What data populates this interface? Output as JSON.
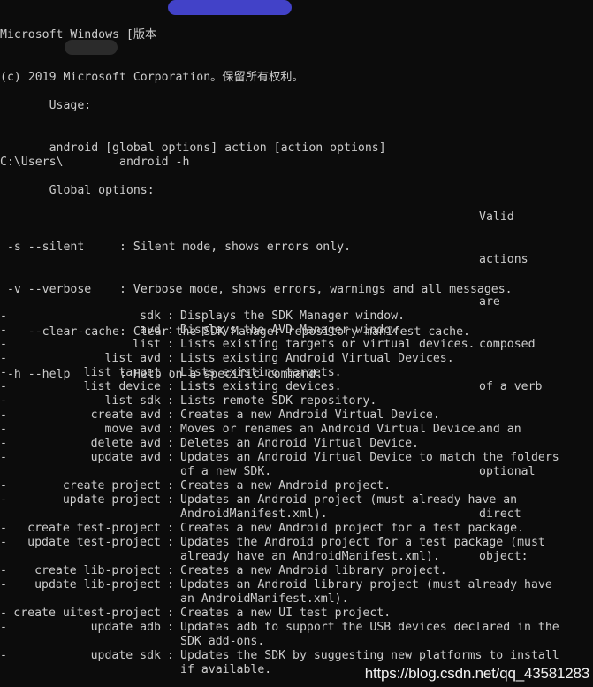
{
  "terminal": {
    "background_color": "#0c0c0c",
    "text_color": "#cccccc",
    "header": {
      "line1": "Microsoft Windows [版本",
      "line2": "(c) 2019 Microsoft Corporation。保留所有权利。",
      "prompt_prefix": "C:\\Users\\",
      "prompt_command": "android -h"
    },
    "redactions": {
      "version_bar_color": "#4242c8",
      "username_bar_color": "#2b2b2b"
    },
    "usage": {
      "heading": "Usage:",
      "syntax": "android [global options] action [action options]",
      "global_options_heading": "Global options:",
      "options": [
        {
          "flags": "-s --silent     ",
          "sep": ": ",
          "desc": "Silent mode, shows errors only."
        },
        {
          "flags": "-v --verbose    ",
          "sep": ": ",
          "desc": "Verbose mode, shows errors, warnings and all messages."
        },
        {
          "flags": "   --clear-cache",
          "sep": ": ",
          "desc": "Clear the SDK Manager repository manifest cache."
        },
        {
          "flags": "-h --help       ",
          "sep": ": ",
          "desc": "Help on a specific command."
        }
      ]
    },
    "valid_actions_note": [
      "Valid",
      "actions",
      "are",
      "composed",
      "of a verb",
      "and an",
      "optional",
      "direct",
      "object:"
    ],
    "actions": [
      {
        "dash": "-",
        "name": "sdk",
        "sep": ":",
        "desc": "Displays the SDK Manager window.",
        "cont": null
      },
      {
        "dash": "-",
        "name": "avd",
        "sep": ":",
        "desc": "Displays the AVD Manager window.",
        "cont": null
      },
      {
        "dash": "-",
        "name": "list",
        "sep": ":",
        "desc": "Lists existing targets or virtual devices.",
        "cont": null
      },
      {
        "dash": "-",
        "name": "list avd",
        "sep": ":",
        "desc": "Lists existing Android Virtual Devices.",
        "cont": null
      },
      {
        "dash": "-",
        "name": "list target",
        "sep": ":",
        "desc": "Lists existing targets.",
        "cont": null
      },
      {
        "dash": "-",
        "name": "list device",
        "sep": ":",
        "desc": "Lists existing devices.",
        "cont": null
      },
      {
        "dash": "-",
        "name": "list sdk",
        "sep": ":",
        "desc": "Lists remote SDK repository.",
        "cont": null
      },
      {
        "dash": "-",
        "name": "create avd",
        "sep": ":",
        "desc": "Creates a new Android Virtual Device.",
        "cont": null
      },
      {
        "dash": "-",
        "name": "move avd",
        "sep": ":",
        "desc": "Moves or renames an Android Virtual Device.",
        "cont": null
      },
      {
        "dash": "-",
        "name": "delete avd",
        "sep": ":",
        "desc": "Deletes an Android Virtual Device.",
        "cont": null
      },
      {
        "dash": "-",
        "name": "update avd",
        "sep": ":",
        "desc": "Updates an Android Virtual Device to match the folders",
        "cont": "of a new SDK."
      },
      {
        "dash": "-",
        "name": "create project",
        "sep": ":",
        "desc": "Creates a new Android project.",
        "cont": null
      },
      {
        "dash": "-",
        "name": "update project",
        "sep": ":",
        "desc": "Updates an Android project (must already have an",
        "cont": "AndroidManifest.xml)."
      },
      {
        "dash": "-",
        "name": "create test-project",
        "sep": ":",
        "desc": "Creates a new Android project for a test package.",
        "cont": null
      },
      {
        "dash": "-",
        "name": "update test-project",
        "sep": ":",
        "desc": "Updates the Android project for a test package (must",
        "cont": "already have an AndroidManifest.xml)."
      },
      {
        "dash": "-",
        "name": "create lib-project",
        "sep": ":",
        "desc": "Creates a new Android library project.",
        "cont": null
      },
      {
        "dash": "-",
        "name": "update lib-project",
        "sep": ":",
        "desc": "Updates an Android library project (must already have",
        "cont": "an AndroidManifest.xml)."
      },
      {
        "dash": "-",
        "name": "create uitest-project",
        "sep": ":",
        "desc": "Creates a new UI test project.",
        "cont": null
      },
      {
        "dash": "-",
        "name": "update adb",
        "sep": ":",
        "desc": "Updates adb to support the USB devices declared in the",
        "cont": "SDK add-ons."
      },
      {
        "dash": "-",
        "name": "update sdk",
        "sep": ":",
        "desc": "Updates the SDK by suggesting new platforms to install",
        "cont": "if available."
      }
    ]
  },
  "watermark": {
    "text": "https://blog.csdn.net/qq_43581283"
  }
}
